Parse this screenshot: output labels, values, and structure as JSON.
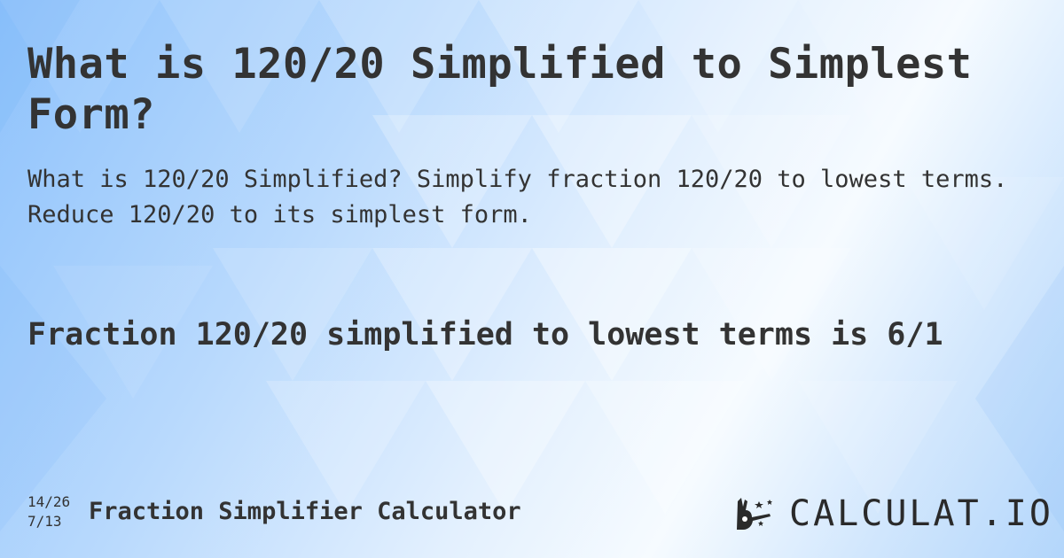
{
  "title": "What is 120/20 Simplified to Simplest Form?",
  "description": "What is 120/20 Simplified? Simplify fraction 120/20 to lowest terms. Reduce 120/20 to its simplest form.",
  "answer": "Fraction 120/20 simplified to lowest terms is 6/1",
  "footer": {
    "fraction_top": "14/26",
    "fraction_bottom": "7/13",
    "calculator_name": "Fraction Simplifier Calculator"
  },
  "logo": {
    "text": "CALCULAT.IO",
    "icon": "magic-hand-wand-icon"
  },
  "colors": {
    "text": "#333333",
    "background_blue": "#8ec2fb",
    "background_light": "#f6fbff"
  }
}
